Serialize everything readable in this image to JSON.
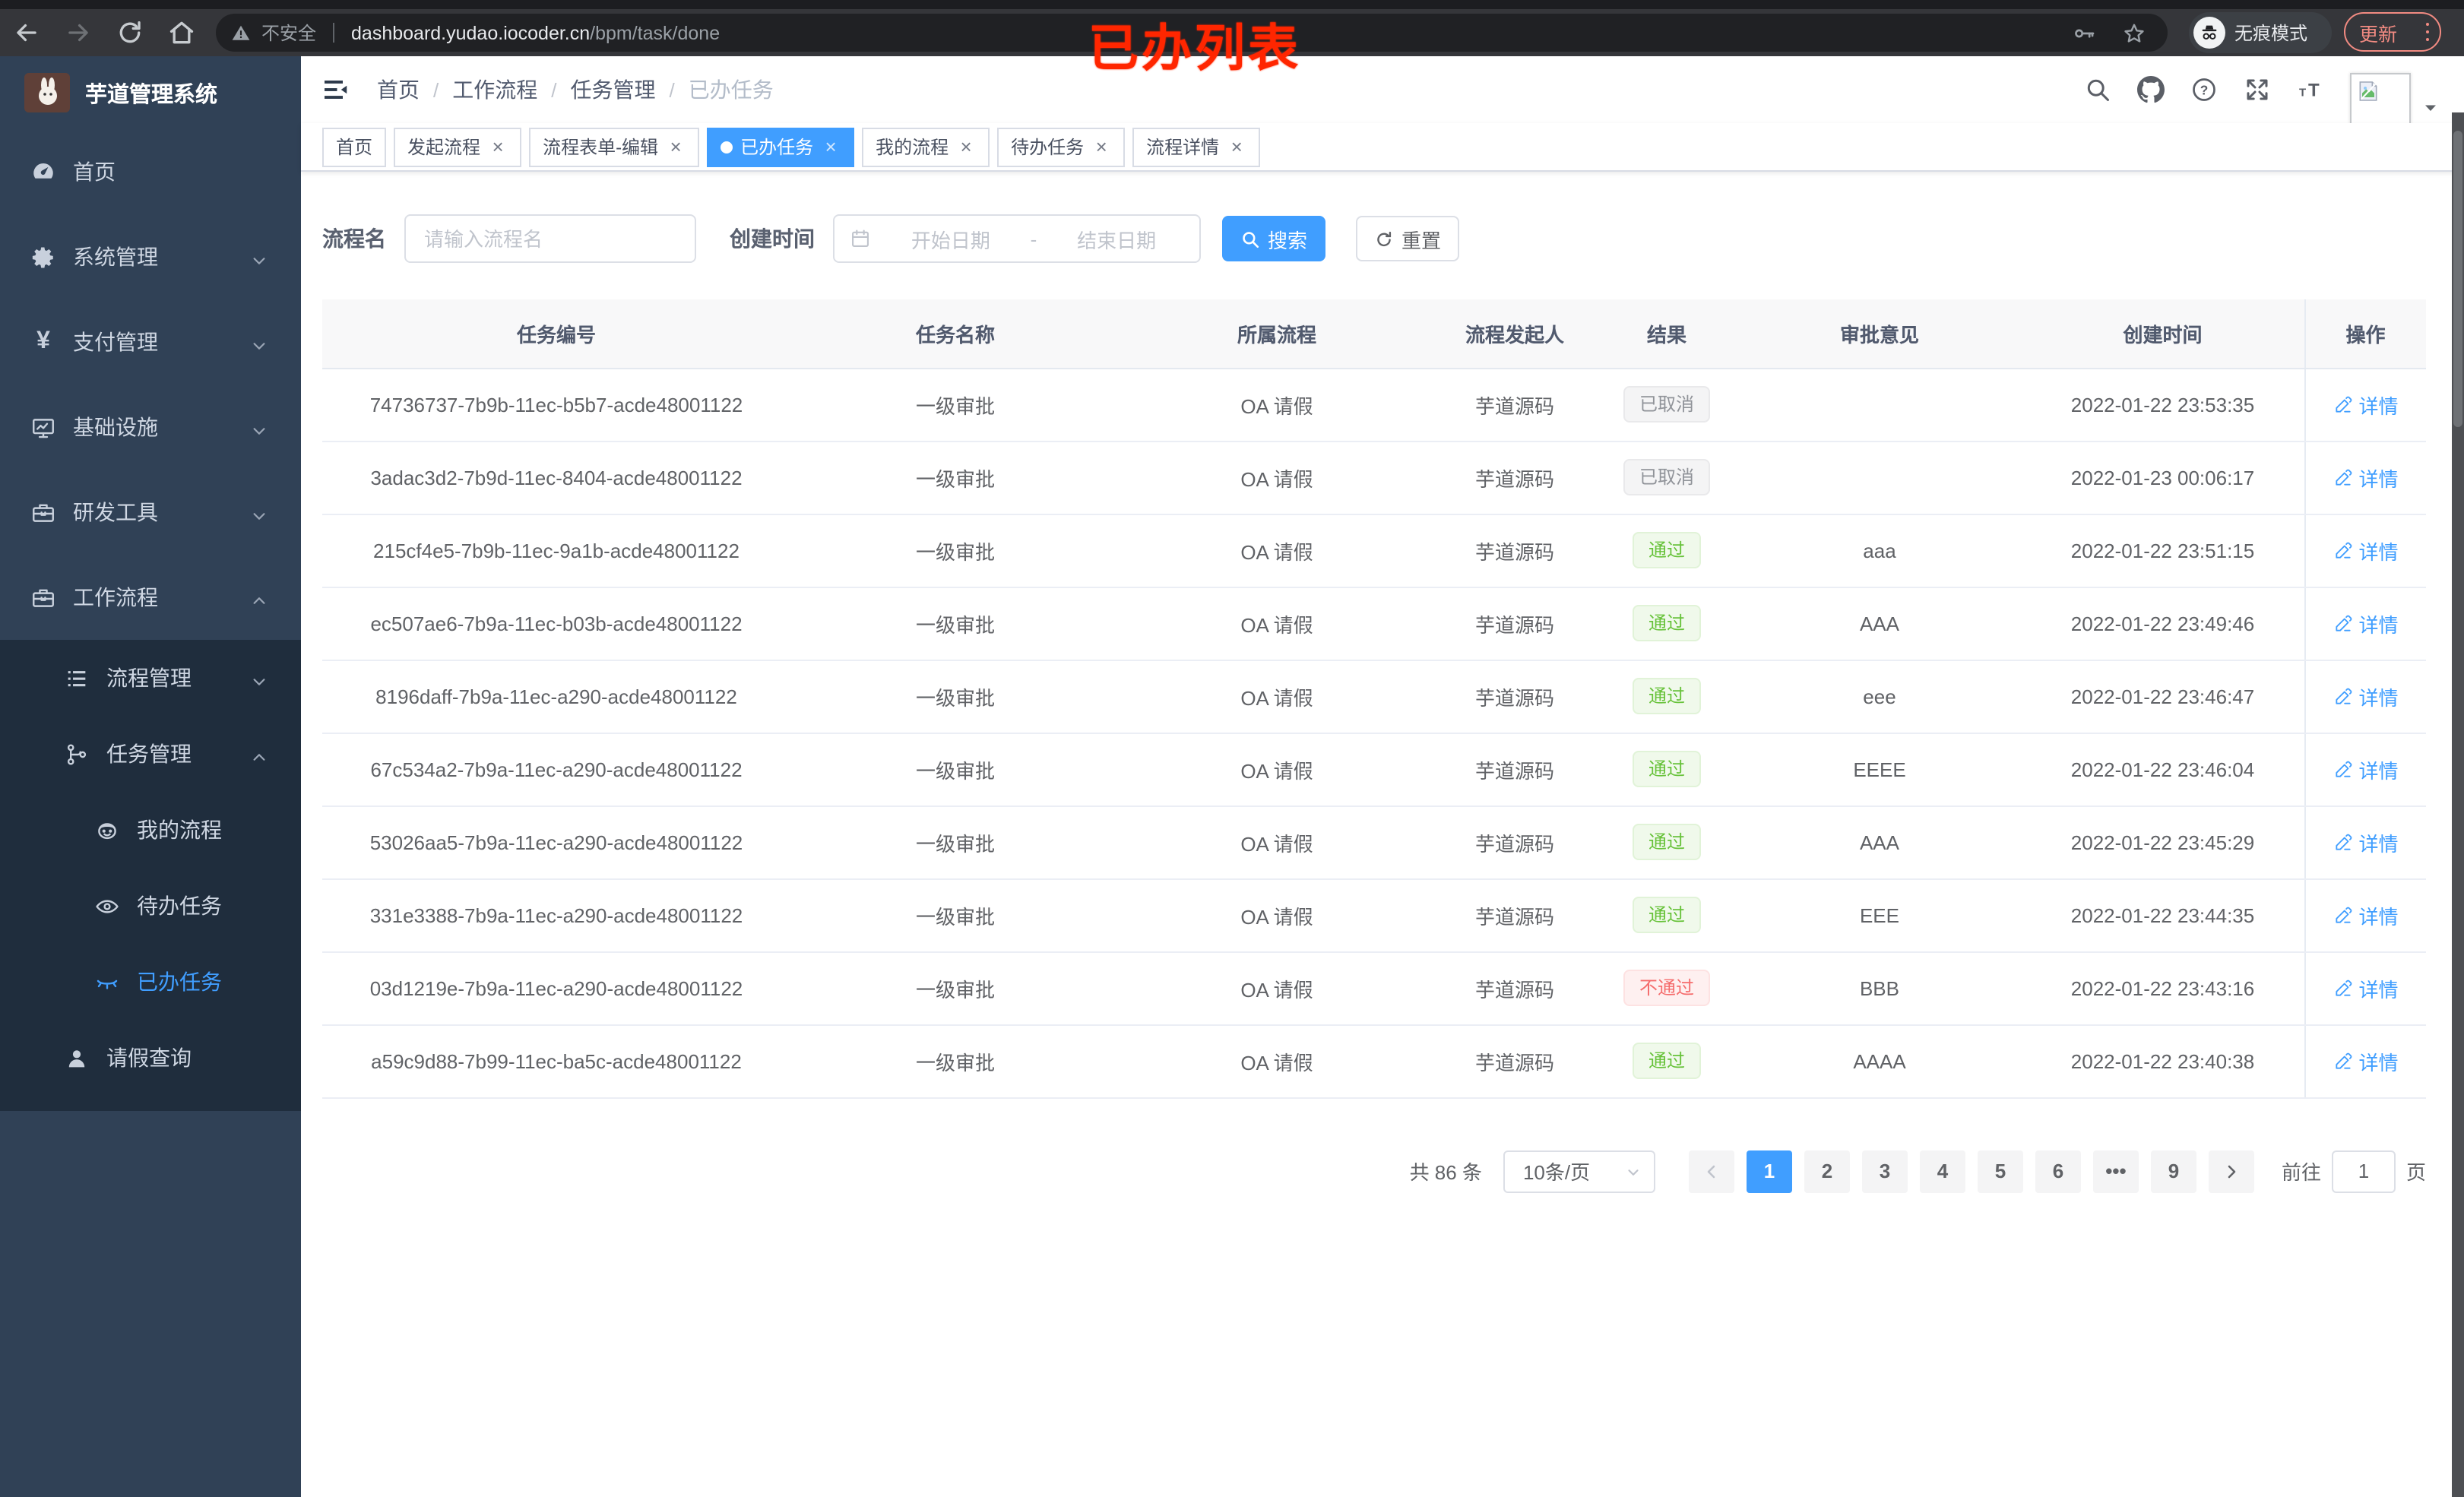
{
  "colors": {
    "accent": "#409eff",
    "success": "#67c23a",
    "danger": "#f56c6c",
    "info": "#909399",
    "annotation_red": "#ff2600",
    "sidebar_bg": "#304156",
    "submenu_bg": "#1f2d3d"
  },
  "browser": {
    "security_label": "不安全",
    "url_domain": "dashboard.yudao.iocoder.cn",
    "url_path": "/bpm/task/done",
    "incognito_label": "无痕模式",
    "update_label": "更新"
  },
  "annotation": {
    "title": "已办列表"
  },
  "sidebar": {
    "app_title": "芋道管理系统",
    "menu": [
      {
        "label": "首页",
        "icon": "dashboard-icon",
        "level": 1,
        "group": "root"
      },
      {
        "label": "系统管理",
        "icon": "gear-icon",
        "level": 1,
        "group": "root",
        "arrow": "down"
      },
      {
        "label": "支付管理",
        "icon": "yen-icon",
        "level": 1,
        "group": "root",
        "arrow": "down"
      },
      {
        "label": "基础设施",
        "icon": "monitor-icon",
        "level": 1,
        "group": "root",
        "arrow": "down"
      },
      {
        "label": "研发工具",
        "icon": "toolbox-icon",
        "level": 1,
        "group": "root",
        "arrow": "down"
      },
      {
        "label": "工作流程",
        "icon": "briefcase-icon",
        "level": 1,
        "group": "root",
        "arrow": "up"
      },
      {
        "label": "流程管理",
        "icon": "list-icon",
        "level": 2,
        "group": "sub",
        "arrow": "down"
      },
      {
        "label": "任务管理",
        "icon": "tree-icon",
        "level": 2,
        "group": "sub",
        "arrow": "up"
      },
      {
        "label": "我的流程",
        "icon": "face-icon",
        "level": 3,
        "group": "sub"
      },
      {
        "label": "待办任务",
        "icon": "eye-icon",
        "level": 3,
        "group": "sub"
      },
      {
        "label": "已办任务",
        "icon": "eye-closed-icon",
        "level": 3,
        "group": "sub",
        "active": true
      },
      {
        "label": "请假查询",
        "icon": "user-icon",
        "level": 2,
        "group": "sub"
      }
    ]
  },
  "breadcrumb": {
    "items": [
      "首页",
      "工作流程",
      "任务管理",
      "已办任务"
    ]
  },
  "tabs": [
    {
      "label": "首页",
      "closable": false
    },
    {
      "label": "发起流程",
      "closable": true
    },
    {
      "label": "流程表单-编辑",
      "closable": true
    },
    {
      "label": "已办任务",
      "closable": true,
      "active": true
    },
    {
      "label": "我的流程",
      "closable": true
    },
    {
      "label": "待办任务",
      "closable": true
    },
    {
      "label": "流程详情",
      "closable": true
    }
  ],
  "filters": {
    "name_label": "流程名",
    "name_placeholder": "请输入流程名",
    "time_label": "创建时间",
    "start_placeholder": "开始日期",
    "separator": "-",
    "end_placeholder": "结束日期",
    "search_label": "搜索",
    "reset_label": "重置"
  },
  "table": {
    "columns": [
      "任务编号",
      "任务名称",
      "所属流程",
      "流程发起人",
      "结果",
      "审批意见",
      "创建时间",
      "操作"
    ],
    "detail_label": "详情",
    "rows": [
      {
        "id": "74736737-7b9b-11ec-b5b7-acde48001122",
        "name": "一级审批",
        "process": "OA 请假",
        "starter": "芋道源码",
        "result": "已取消",
        "result_type": "info",
        "comment": "",
        "time": "2022-01-22 23:53:35"
      },
      {
        "id": "3adac3d2-7b9d-11ec-8404-acde48001122",
        "name": "一级审批",
        "process": "OA 请假",
        "starter": "芋道源码",
        "result": "已取消",
        "result_type": "info",
        "comment": "",
        "time": "2022-01-23 00:06:17"
      },
      {
        "id": "215cf4e5-7b9b-11ec-9a1b-acde48001122",
        "name": "一级审批",
        "process": "OA 请假",
        "starter": "芋道源码",
        "result": "通过",
        "result_type": "success",
        "comment": "aaa",
        "time": "2022-01-22 23:51:15"
      },
      {
        "id": "ec507ae6-7b9a-11ec-b03b-acde48001122",
        "name": "一级审批",
        "process": "OA 请假",
        "starter": "芋道源码",
        "result": "通过",
        "result_type": "success",
        "comment": "AAA",
        "time": "2022-01-22 23:49:46"
      },
      {
        "id": "8196daff-7b9a-11ec-a290-acde48001122",
        "name": "一级审批",
        "process": "OA 请假",
        "starter": "芋道源码",
        "result": "通过",
        "result_type": "success",
        "comment": "eee",
        "time": "2022-01-22 23:46:47"
      },
      {
        "id": "67c534a2-7b9a-11ec-a290-acde48001122",
        "name": "一级审批",
        "process": "OA 请假",
        "starter": "芋道源码",
        "result": "通过",
        "result_type": "success",
        "comment": "EEEE",
        "time": "2022-01-22 23:46:04"
      },
      {
        "id": "53026aa5-7b9a-11ec-a290-acde48001122",
        "name": "一级审批",
        "process": "OA 请假",
        "starter": "芋道源码",
        "result": "通过",
        "result_type": "success",
        "comment": "AAA",
        "time": "2022-01-22 23:45:29"
      },
      {
        "id": "331e3388-7b9a-11ec-a290-acde48001122",
        "name": "一级审批",
        "process": "OA 请假",
        "starter": "芋道源码",
        "result": "通过",
        "result_type": "success",
        "comment": "EEE",
        "time": "2022-01-22 23:44:35"
      },
      {
        "id": "03d1219e-7b9a-11ec-a290-acde48001122",
        "name": "一级审批",
        "process": "OA 请假",
        "starter": "芋道源码",
        "result": "不通过",
        "result_type": "danger",
        "comment": "BBB",
        "time": "2022-01-22 23:43:16"
      },
      {
        "id": "a59c9d88-7b99-11ec-ba5c-acde48001122",
        "name": "一级审批",
        "process": "OA 请假",
        "starter": "芋道源码",
        "result": "通过",
        "result_type": "success",
        "comment": "AAAA",
        "time": "2022-01-22 23:40:38"
      }
    ]
  },
  "pagination": {
    "total_text": "共 86 条",
    "page_size": "10条/页",
    "pages": [
      "1",
      "2",
      "3",
      "4",
      "5",
      "6",
      "...",
      "9"
    ],
    "active_page": "1",
    "goto_label": "前往",
    "goto_value": "1",
    "page_label": "页"
  }
}
